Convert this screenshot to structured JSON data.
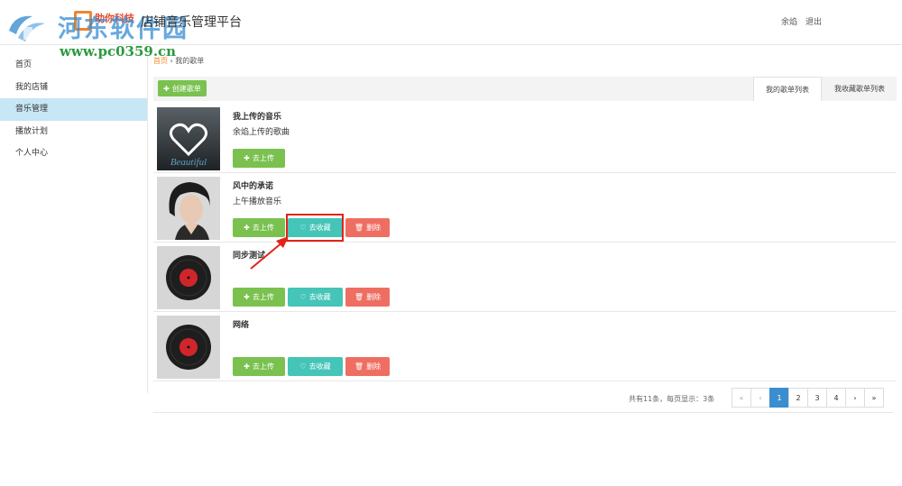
{
  "watermark": {
    "text": "河东软件园",
    "url": "www.pc0359.cn",
    "brand_sub": "助你科技"
  },
  "header": {
    "app_title": "店铺音乐管理平台",
    "user_name": "余焰",
    "logout": "退出"
  },
  "sidebar": {
    "items": [
      {
        "label": "首页"
      },
      {
        "label": "我的店铺"
      },
      {
        "label": "音乐管理"
      },
      {
        "label": "播放计划"
      },
      {
        "label": "个人中心"
      }
    ]
  },
  "breadcrumb": {
    "home": "首页",
    "separator": "›",
    "current": "我的歌单"
  },
  "toolbar": {
    "create_label": "创建歌单",
    "tab_mine": "我的歌单列表",
    "tab_fav": "我收藏歌单列表"
  },
  "buttons": {
    "upload": "去上传",
    "favorite": "去收藏",
    "delete": "删除"
  },
  "playlists": [
    {
      "title": "我上传的音乐",
      "desc": "余焰上传的歌曲",
      "cover_text": "Beautiful"
    },
    {
      "title": "风中的承诺",
      "desc": "上午播放音乐"
    },
    {
      "title": "同步测试",
      "desc": ""
    },
    {
      "title": "网络",
      "desc": ""
    }
  ],
  "pagination": {
    "summary": "共有11条，每页显示：3条",
    "first": "«",
    "prev": "‹",
    "pages": [
      "1",
      "2",
      "3",
      "4"
    ],
    "next": "›",
    "last": "»"
  },
  "colors": {
    "accent_blue": "#3a8ed0",
    "green": "#7ac14f",
    "teal": "#45c4b8",
    "red": "#ef6e62",
    "sidebar_active": "#c7e6f6",
    "highlight": "#e2231a"
  }
}
